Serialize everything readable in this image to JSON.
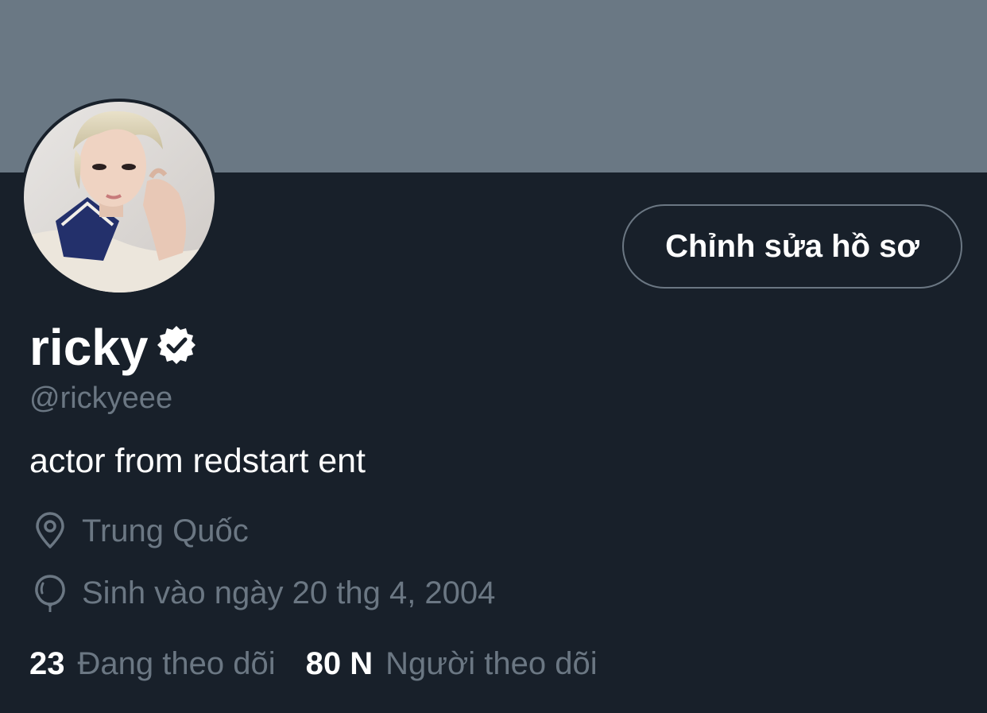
{
  "header": {
    "banner_color": "#6a7884"
  },
  "profile": {
    "edit_button_label": "Chỉnh sửa hồ sơ",
    "display_name": "ricky",
    "verified": true,
    "handle": "@rickyeee",
    "bio": "actor from redstart ent",
    "location": "Trung Quốc",
    "location_icon": "location-pin-icon",
    "birth_date": "Sinh vào ngày 20 thg 4, 2004",
    "birth_icon": "balloon-icon"
  },
  "stats": {
    "following_count": "23",
    "following_label": "Đang theo dõi",
    "followers_count": "80 N",
    "followers_label": "Người theo dõi"
  },
  "colors": {
    "background": "#18202a",
    "muted_text": "#6b7783",
    "primary_text": "#ffffff",
    "button_border": "#6b7783"
  }
}
